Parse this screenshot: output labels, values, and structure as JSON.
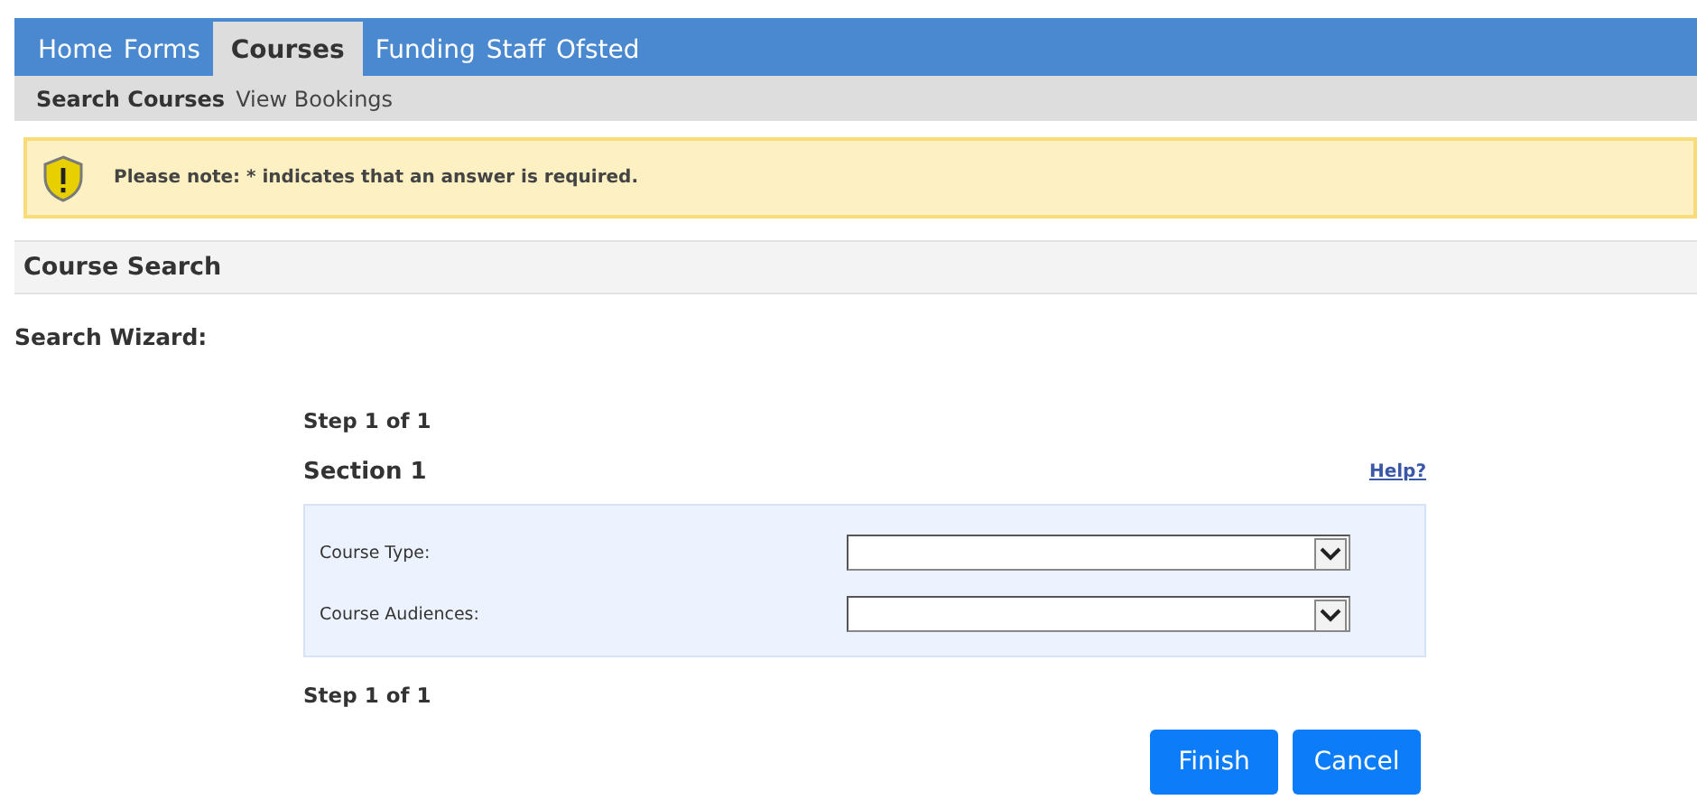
{
  "tabs": [
    {
      "label": "Home",
      "selected": false
    },
    {
      "label": "Forms",
      "selected": false
    },
    {
      "label": "Courses",
      "selected": true
    },
    {
      "label": "Funding",
      "selected": false
    },
    {
      "label": "Staff",
      "selected": false
    },
    {
      "label": "Ofsted",
      "selected": false
    }
  ],
  "subtabs": [
    {
      "label": "Search Courses",
      "selected": true
    },
    {
      "label": "View Bookings",
      "selected": false
    }
  ],
  "notice": {
    "text": "Please note: * indicates that an answer is required."
  },
  "panel_title": "Course Search",
  "wizard_label": "Search Wizard:",
  "step_top": "Step 1 of 1",
  "section": {
    "title": "Section 1",
    "help": "Help?"
  },
  "fields": [
    {
      "label": "Course Type:"
    },
    {
      "label": "Course Audiences:"
    }
  ],
  "step_bottom": "Step 1 of 1",
  "buttons": [
    "Finish",
    "Cancel"
  ]
}
